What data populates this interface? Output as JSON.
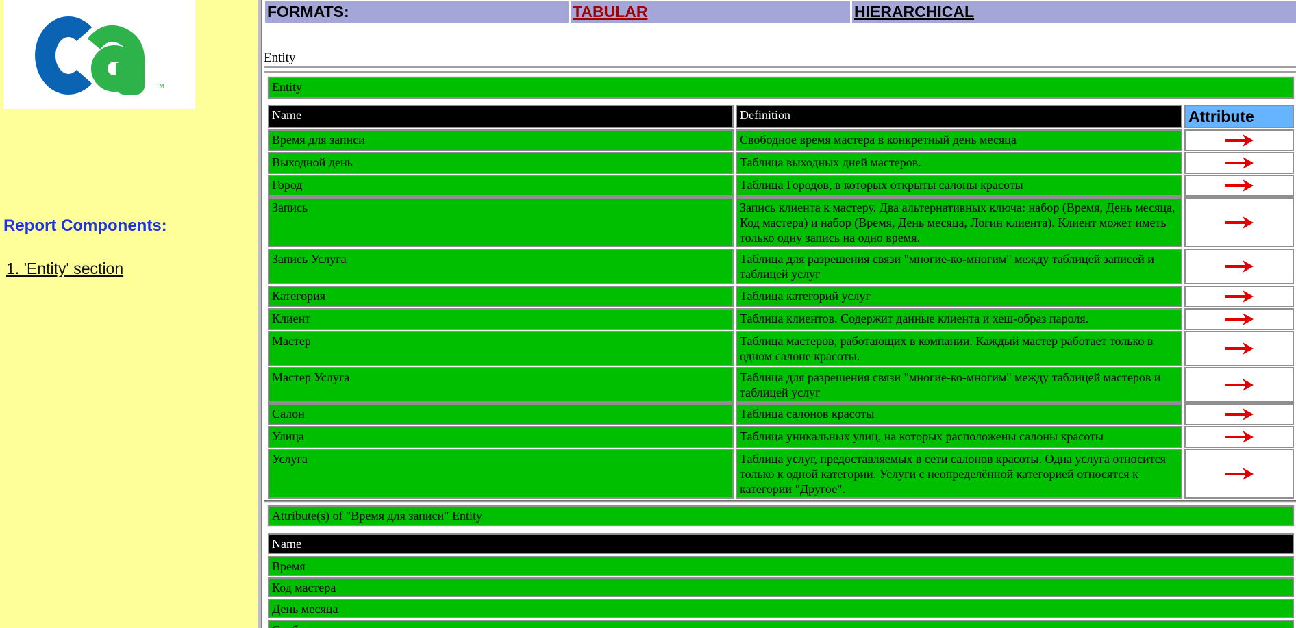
{
  "left_pane": {
    "logo": "ca",
    "report_components_title": "Report Components:",
    "section_link": "1. 'Entity' section"
  },
  "formats_bar": {
    "label": "FORMATS:",
    "tabular": "TABULAR",
    "hierarchical": "HIERARCHICAL"
  },
  "entity_caption": "Entity",
  "entity_section_title": "Entity",
  "entity_table": {
    "headers": {
      "name": "Name",
      "definition": "Definition",
      "attribute": "Attribute"
    },
    "rows": [
      {
        "name": "Время для записи",
        "definition": "Свободное время мастера в конкретный день месяца"
      },
      {
        "name": "Выходной день",
        "definition": "Таблица выходных дней мастеров."
      },
      {
        "name": "Город",
        "definition": "Таблица Городов, в которых открыты салоны красоты"
      },
      {
        "name": "Запись",
        "definition": "Запись клиента к мастеру. Два альтернативных ключа: набор (Время, День месяца, Код мастера) и набор (Время, День месяца, Логин клиента). Клиент может иметь только одну запись на одно время."
      },
      {
        "name": "Запись Услуга",
        "definition": "Таблица для разрешения связи \"многие-ко-многим\" между таблицей записей и таблицей услуг"
      },
      {
        "name": "Категория",
        "definition": "Таблица категорий услуг"
      },
      {
        "name": "Клиент",
        "definition": "Таблица клиентов. Содержит данные клиента и хеш-образ пароля."
      },
      {
        "name": "Мастер",
        "definition": "Таблица мастеров, работающих в компании. Каждый мастер работает только в одном салоне красоты."
      },
      {
        "name": "Мастер Услуга",
        "definition": "Таблица для разрешения связи \"многие-ко-многим\" между таблицей мастеров и таблицей услуг"
      },
      {
        "name": "Салон",
        "definition": "Таблица салонов красоты"
      },
      {
        "name": "Улица",
        "definition": "Таблица уникальных улиц, на которых расположены салоны красоты"
      },
      {
        "name": "Услуга",
        "definition": "Таблица услуг, предоставляемых в сети салонов красоты. Одна услуга относится только к одной категории. Услуги с неопределённой категорией относятся к категории \"Другое\"."
      }
    ]
  },
  "attributes_section_title": "Attribute(s) of \"Время для записи\" Entity",
  "attributes_table": {
    "header": "Name",
    "rows": [
      "Время",
      "Код мастера",
      "День месяца",
      "Свободно"
    ]
  },
  "colors": {
    "left_bg": "#ffff99",
    "green": "#00bf00",
    "formats_bg": "#a4a6d8",
    "attribute_header_bg": "#66b3ff",
    "report_title": "#1a33e6",
    "tabular_link": "#a00000",
    "arrow": "#e00000"
  },
  "icons": {
    "attribute_link": "red-right-arrow-icon"
  }
}
